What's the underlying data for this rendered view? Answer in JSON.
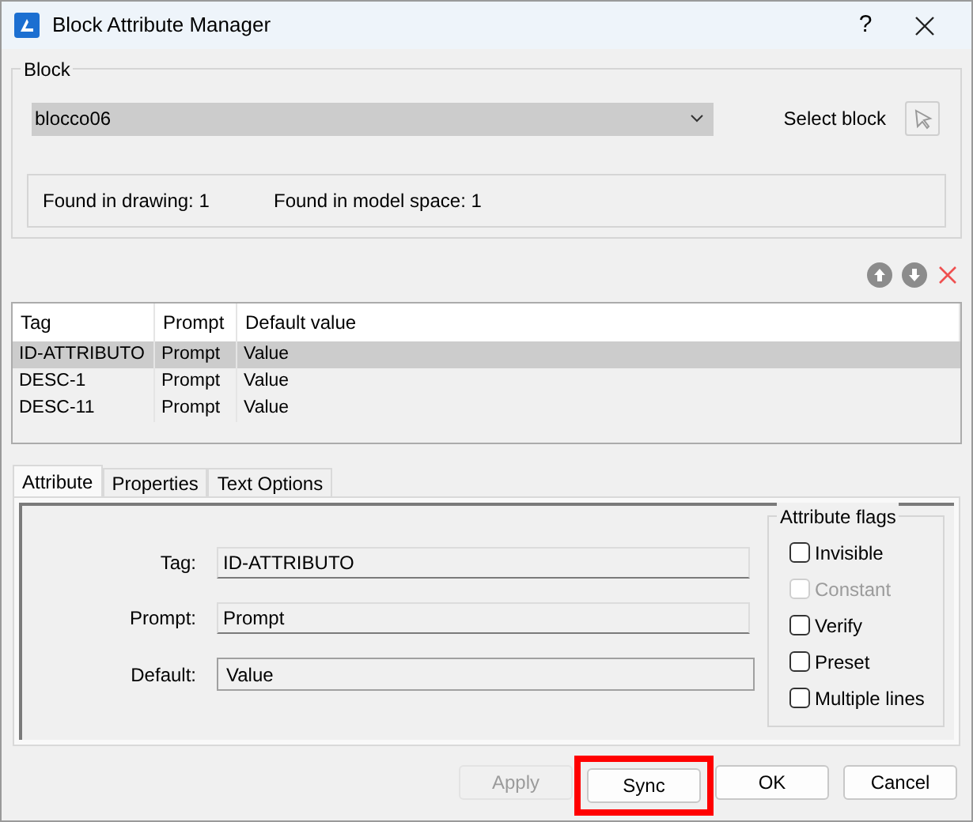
{
  "window": {
    "title": "Block Attribute Manager",
    "help": "?"
  },
  "block": {
    "label": "Block",
    "value": "blocco06",
    "select_label": "Select block",
    "found_in_drawing": "Found in drawing: 1",
    "found_in_model_space": "Found in model space: 1"
  },
  "table": {
    "columns": [
      "Tag",
      "Prompt",
      "Default value"
    ],
    "rows": [
      {
        "cells": [
          "ID-ATTRIBUTO",
          "Prompt",
          "Value"
        ],
        "selected": true
      },
      {
        "cells": [
          "DESC-1",
          "Prompt",
          "Value"
        ],
        "selected": false
      },
      {
        "cells": [
          "DESC-11",
          "Prompt",
          "Value"
        ],
        "selected": false
      }
    ]
  },
  "tabs": [
    {
      "label": "Attribute",
      "selected": true
    },
    {
      "label": "Properties",
      "selected": false
    },
    {
      "label": "Text Options",
      "selected": false
    }
  ],
  "fields": [
    {
      "label": "Tag:",
      "value": "ID-ATTRIBUTO",
      "kind": "readonly"
    },
    {
      "label": "Prompt:",
      "value": "Prompt",
      "kind": "readonly"
    },
    {
      "label": "Default:",
      "value": "Value",
      "kind": "editable"
    }
  ],
  "flags": {
    "title": "Attribute flags",
    "items": [
      {
        "label": "Invisible",
        "checked": false,
        "disabled": false
      },
      {
        "label": "Constant",
        "checked": false,
        "disabled": true
      },
      {
        "label": "Verify",
        "checked": false,
        "disabled": false
      },
      {
        "label": "Preset",
        "checked": false,
        "disabled": false
      },
      {
        "label": "Multiple lines",
        "checked": false,
        "disabled": false
      }
    ]
  },
  "buttons": [
    {
      "label": "Apply",
      "disabled": true,
      "highlighted": false
    },
    {
      "label": "Sync",
      "disabled": false,
      "highlighted": true
    },
    {
      "label": "OK",
      "disabled": false,
      "highlighted": false
    },
    {
      "label": "Cancel",
      "disabled": false,
      "highlighted": false
    }
  ]
}
